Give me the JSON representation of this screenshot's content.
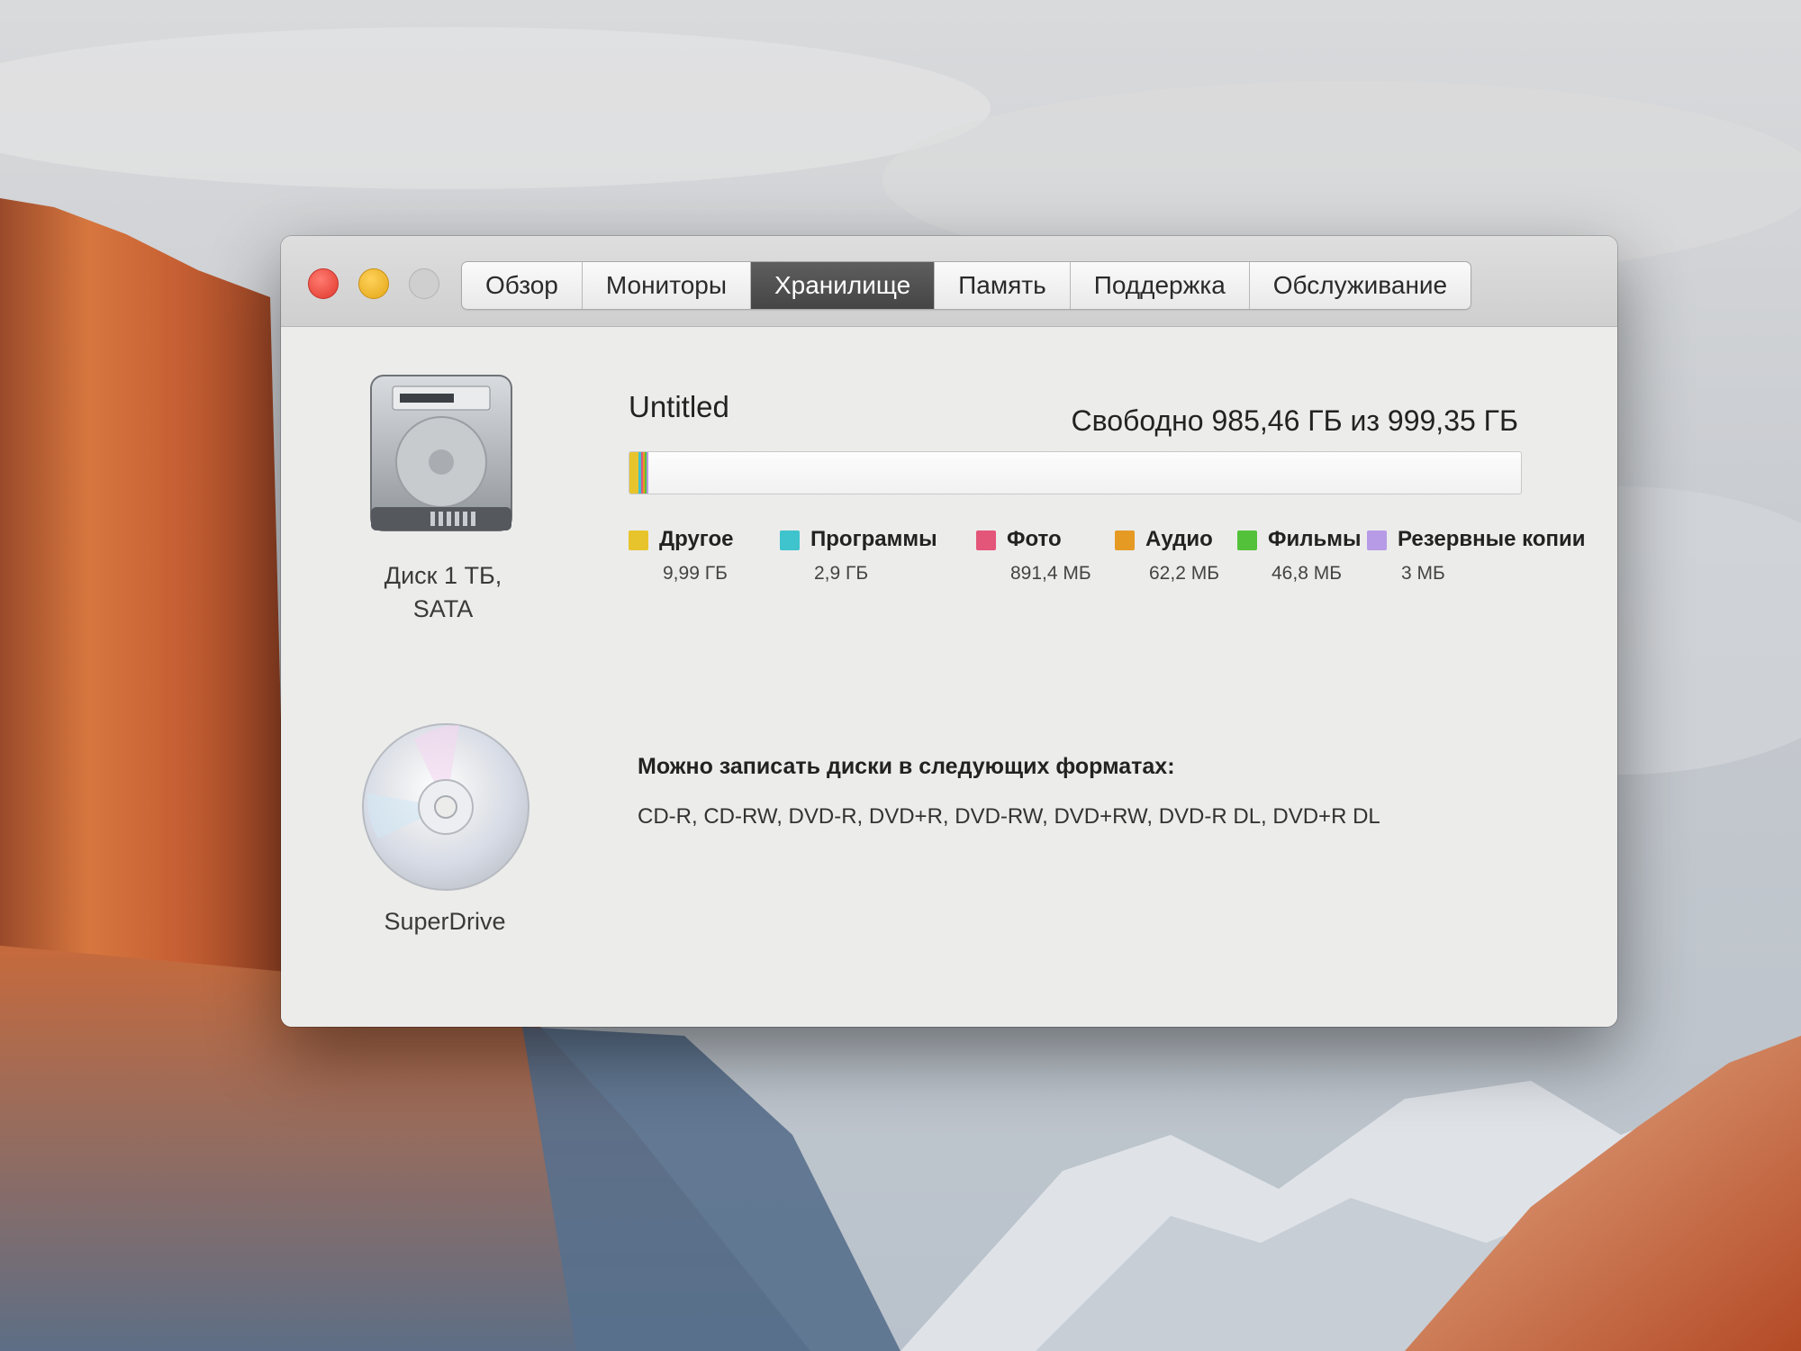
{
  "window": {
    "tabs": [
      {
        "label": "Обзор",
        "active": false
      },
      {
        "label": "Мониторы",
        "active": false
      },
      {
        "label": "Хранилище",
        "active": true
      },
      {
        "label": "Память",
        "active": false
      },
      {
        "label": "Поддержка",
        "active": false
      },
      {
        "label": "Обслуживание",
        "active": false
      }
    ]
  },
  "devices": [
    {
      "name": "Диск 1 ТБ, SATA",
      "line1": "Диск 1 ТБ,",
      "line2": "SATA",
      "icon": "hard-drive-icon"
    },
    {
      "name": "SuperDrive",
      "icon": "optical-disc-icon"
    }
  ],
  "storage": {
    "volume_name": "Untitled",
    "free_text": "Свободно 985,46 ГБ из 999,35 ГБ",
    "free_gb": 985.46,
    "total_gb": 999.35,
    "categories": [
      {
        "name": "Другое",
        "size": "9,99 ГБ",
        "size_gb": 9.99,
        "color": "#e8c42c"
      },
      {
        "name": "Программы",
        "size": "2,9 ГБ",
        "size_gb": 2.9,
        "color": "#3fc3cc"
      },
      {
        "name": "Фото",
        "size": "891,4 МБ",
        "size_gb": 0.8914,
        "color": "#e4557a"
      },
      {
        "name": "Аудио",
        "size": "62,2 МБ",
        "size_gb": 0.0622,
        "color": "#e59a24"
      },
      {
        "name": "Фильмы",
        "size": "46,8 МБ",
        "size_gb": 0.0468,
        "color": "#53c23a"
      },
      {
        "name": "Резервные копии",
        "size": "3 МБ",
        "size_gb": 0.003,
        "color": "#b79be6"
      }
    ]
  },
  "formats": {
    "title": "Можно записать диски в следующих форматах:",
    "list": "CD-R, CD-RW, DVD-R, DVD+R, DVD-RW, DVD+RW, DVD-R DL, DVD+R DL"
  }
}
